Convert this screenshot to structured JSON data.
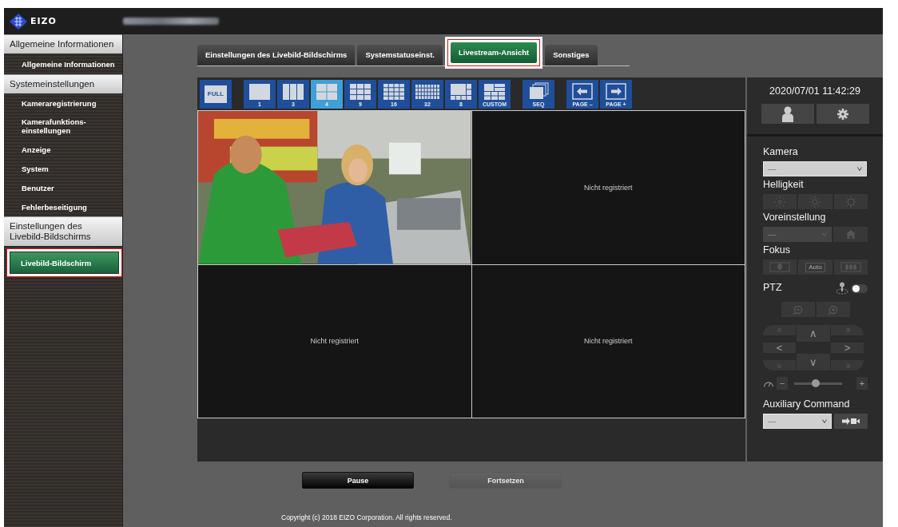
{
  "header": {
    "logo": "EIZO"
  },
  "sidebar": {
    "sections": [
      {
        "title": "Allgemeine Informationen",
        "items": [
          {
            "label": "Allgemeine Informationen",
            "selected": false,
            "highlighted": false
          }
        ]
      },
      {
        "title": "Systemeinstellungen",
        "items": [
          {
            "label": "Kameraregistrierung",
            "selected": false,
            "highlighted": false
          },
          {
            "label": "Kamerafunktions-einstellungen",
            "selected": false,
            "highlighted": false
          },
          {
            "label": "Anzeige",
            "selected": false,
            "highlighted": false
          },
          {
            "label": "System",
            "selected": false,
            "highlighted": false
          },
          {
            "label": "Benutzer",
            "selected": false,
            "highlighted": false
          },
          {
            "label": "Fehlerbeseitigung",
            "selected": false,
            "highlighted": false
          }
        ]
      },
      {
        "title": "Einstellungen des Livebild-Bildschirms",
        "items": [
          {
            "label": "Livebild-Bildschirm",
            "selected": true,
            "highlighted": true
          }
        ]
      }
    ]
  },
  "tabs": [
    {
      "label": "Einstellungen des Livebild-Bildschirms",
      "selected": false,
      "highlighted": false
    },
    {
      "label": "Systemstatuseinst.",
      "selected": false,
      "highlighted": false
    },
    {
      "label": "Livestream-Ansicht",
      "selected": true,
      "highlighted": true
    },
    {
      "label": "Sonstiges",
      "selected": false,
      "highlighted": false
    }
  ],
  "toolbar": {
    "buttons": [
      {
        "kind": "full",
        "label": "FULL",
        "selected": false
      },
      {
        "kind": "single",
        "label": "1",
        "selected": false
      },
      {
        "kind": "split3",
        "label": "3",
        "selected": false
      },
      {
        "kind": "quad",
        "label": "4",
        "selected": true
      },
      {
        "kind": "grid9",
        "label": "9",
        "selected": false
      },
      {
        "kind": "grid16",
        "label": "16",
        "selected": false
      },
      {
        "kind": "grid32",
        "label": "32",
        "selected": false
      },
      {
        "kind": "split8",
        "label": "8",
        "selected": false
      },
      {
        "kind": "custom",
        "label": "CUSTOM",
        "selected": false
      },
      {
        "kind": "seq",
        "label": "SEQ",
        "selected": false
      },
      {
        "kind": "page-prev",
        "label": "PAGE –",
        "selected": false
      },
      {
        "kind": "page-next",
        "label": "PAGE +",
        "selected": false
      }
    ]
  },
  "video_grid": {
    "cells": [
      {
        "kind": "picture"
      },
      {
        "kind": "empty",
        "text": "Nicht registriert"
      },
      {
        "kind": "empty",
        "text": "Nicht registriert"
      },
      {
        "kind": "empty",
        "text": "Nicht registriert"
      }
    ]
  },
  "control_panel": {
    "datetime": "2020/07/01 11:42:29",
    "camera": {
      "label": "Kamera",
      "value": "----",
      "disabled": false
    },
    "brightness": {
      "label": "Helligkeit",
      "disabled": true
    },
    "preset": {
      "label": "Voreinstellung",
      "value": "----",
      "disabled": true
    },
    "focus": {
      "label": "Fokus",
      "auto_label": "Auto",
      "disabled": true
    },
    "ptz": {
      "label": "PTZ",
      "joystick_on": false,
      "disabled": true,
      "up": "∧",
      "down": "∨",
      "left": "<",
      "right": ">",
      "minus": "−",
      "plus": "+",
      "level": 0.45
    },
    "auxiliary": {
      "label": "Auxiliary Command",
      "value": "----",
      "disabled": false
    }
  },
  "actions": [
    {
      "label": "Pause",
      "disabled": false
    },
    {
      "label": "Fortsetzen",
      "disabled": true
    }
  ],
  "footer": {
    "copyright": "Copyright (c) 2018 EIZO Corporation. All rights reserved."
  }
}
